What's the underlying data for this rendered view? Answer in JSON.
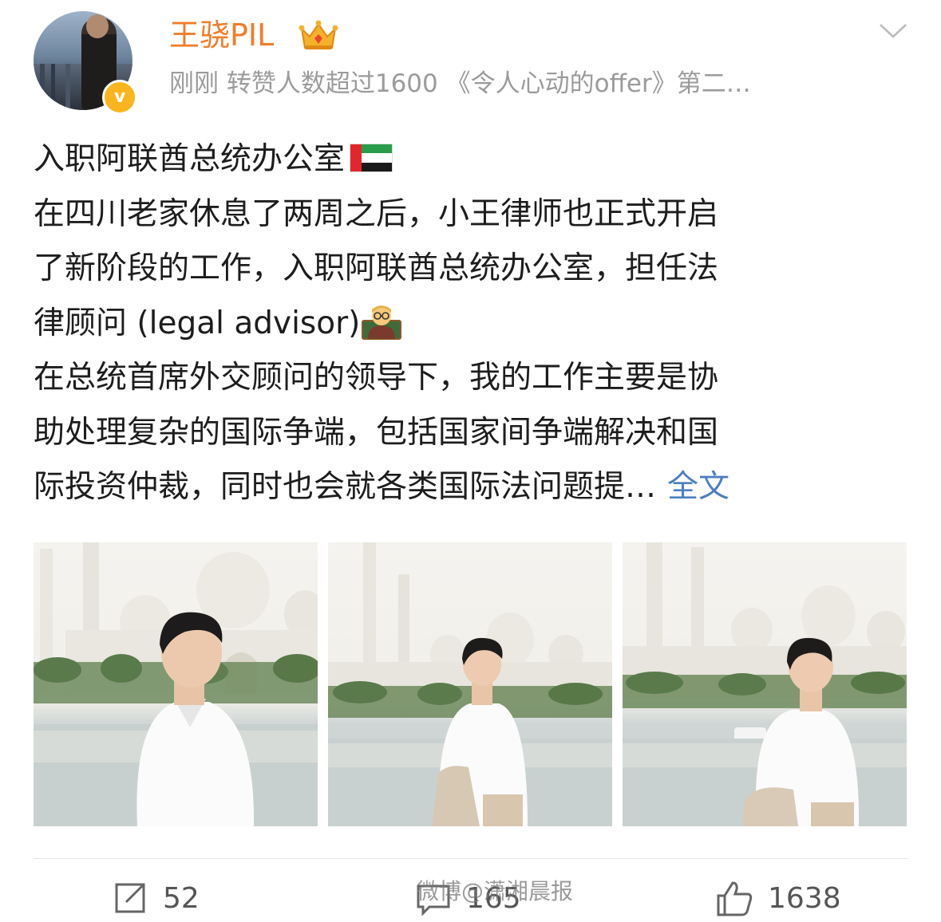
{
  "user": {
    "name": "王骁PIL",
    "meta": "刚刚  转赞人数超过1600 《令人心动的offer》第二…",
    "verified_mark": "v"
  },
  "post": {
    "lines": [
      "入职阿联酋总统办公室",
      "在四川老家休息了两周之后，小王律师也正式开启",
      "了新阶段的工作，入职阿联酋总统办公室，担任法",
      "律顾问 (legal advisor)",
      "在总统首席外交顾问的领导下，我的工作主要是协",
      "助处理复杂的国际争端，包括国家间争端解决和国",
      "际投资仲裁，同时也会就各类国际法问题提…"
    ],
    "expand_label": "全文"
  },
  "actions": {
    "repost_count": "52",
    "comment_count": "165",
    "like_count": "1638"
  },
  "watermark": "微博@潇湘晨报",
  "colors": {
    "username": "#f07d2a",
    "link": "#4e7fc0",
    "meta": "#9b9b9b",
    "verified": "#f8b51d"
  },
  "icons": [
    "crown-icon",
    "chevron-down-icon",
    "uae-flag-icon",
    "teacher-icon",
    "repost-icon",
    "comment-icon",
    "like-icon"
  ]
}
